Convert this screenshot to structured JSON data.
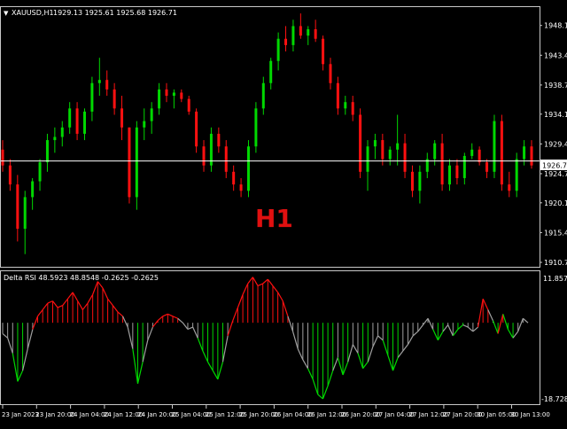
{
  "main_header": {
    "triangle": "▼",
    "symbol_timeframe": "XAUUSD,H1",
    "ohlc": "1929.13 1925.61 1925.68 1926.71"
  },
  "watermark": "H1",
  "price_axis": {
    "labels": [
      "1948.10",
      "1943.40",
      "1938.70",
      "1934.10",
      "1929.40",
      "1924.70",
      "1920.10",
      "1915.40",
      "1910.70"
    ],
    "current_price": "1926.71"
  },
  "indicator_header": "Delta RSI 48.5923 48.8548 -0.2625 -0.2625",
  "indicator_axis": {
    "top": "11.8576",
    "bottom": "-18.7285"
  },
  "time_axis": {
    "labels": [
      "23 Jan 2023",
      "23 Jan 20:00",
      "24 Jan 04:00",
      "24 Jan 12:00",
      "24 Jan 20:00",
      "25 Jan 04:00",
      "25 Jan 12:00",
      "25 Jan 20:00",
      "26 Jan 04:00",
      "26 Jan 12:00",
      "26 Jan 20:00",
      "27 Jan 04:00",
      "27 Jan 12:00",
      "27 Jan 20:00",
      "30 Jan 05:00",
      "30 Jan 13:00"
    ]
  },
  "colors": {
    "background": "#000000",
    "bull": "#00d800",
    "bear": "#ff1010",
    "neutral": "#a0a0a0",
    "frame": "#c8c8c8",
    "text": "#ffffff",
    "watermark": "#e01010"
  },
  "chart_data": [
    {
      "type": "candlestick",
      "y_axis_ticks": [
        1948.1,
        1943.4,
        1938.7,
        1934.1,
        1929.4,
        1924.7,
        1920.1,
        1915.4,
        1910.7
      ],
      "ylim": [
        1910.0,
        1951.0
      ],
      "current_price": 1926.71,
      "ohlc": [
        [
          1928.5,
          1930.0,
          1925.0,
          1926.0
        ],
        [
          1926.0,
          1927.0,
          1922.0,
          1923.0
        ],
        [
          1923.0,
          1924.5,
          1914.0,
          1916.0
        ],
        [
          1916.0,
          1922.0,
          1912.0,
          1921.0
        ],
        [
          1921.0,
          1924.0,
          1919.0,
          1923.5
        ],
        [
          1923.5,
          1927.0,
          1922.0,
          1926.5
        ],
        [
          1926.5,
          1931.0,
          1925.0,
          1930.0
        ],
        [
          1930.0,
          1932.0,
          1928.0,
          1930.5
        ],
        [
          1930.5,
          1933.0,
          1929.0,
          1932.0
        ],
        [
          1932.0,
          1936.0,
          1931.0,
          1935.0
        ],
        [
          1935.0,
          1936.0,
          1930.0,
          1931.0
        ],
        [
          1931.0,
          1935.0,
          1930.0,
          1934.5
        ],
        [
          1934.5,
          1940.0,
          1933.0,
          1939.0
        ],
        [
          1939.0,
          1943.0,
          1937.0,
          1939.5
        ],
        [
          1939.5,
          1941.0,
          1937.0,
          1938.0
        ],
        [
          1938.0,
          1939.0,
          1934.0,
          1935.0
        ],
        [
          1935.0,
          1937.0,
          1930.0,
          1932.0
        ],
        [
          1932.0,
          1932.0,
          1920.0,
          1921.0
        ],
        [
          1921.0,
          1933.0,
          1919.0,
          1932.0
        ],
        [
          1932.0,
          1935.0,
          1930.0,
          1933.0
        ],
        [
          1933.0,
          1936.0,
          1931.0,
          1935.0
        ],
        [
          1935.0,
          1939.0,
          1934.0,
          1938.0
        ],
        [
          1938.0,
          1939.0,
          1936.0,
          1937.0
        ],
        [
          1937.0,
          1938.0,
          1935.0,
          1937.5
        ],
        [
          1937.5,
          1938.0,
          1936.0,
          1936.5
        ],
        [
          1936.5,
          1937.0,
          1934.0,
          1934.5
        ],
        [
          1934.5,
          1935.0,
          1928.0,
          1929.0
        ],
        [
          1929.0,
          1930.0,
          1925.0,
          1926.0
        ],
        [
          1926.0,
          1932.0,
          1925.0,
          1931.0
        ],
        [
          1931.0,
          1932.0,
          1928.0,
          1929.0
        ],
        [
          1929.0,
          1930.0,
          1924.0,
          1925.0
        ],
        [
          1925.0,
          1926.0,
          1922.0,
          1923.0
        ],
        [
          1923.0,
          1924.0,
          1921.0,
          1922.0
        ],
        [
          1922.0,
          1930.0,
          1921.0,
          1929.0
        ],
        [
          1929.0,
          1936.0,
          1928.0,
          1935.0
        ],
        [
          1935.0,
          1940.0,
          1934.0,
          1939.0
        ],
        [
          1939.0,
          1943.0,
          1938.0,
          1942.5
        ],
        [
          1942.5,
          1947.0,
          1941.0,
          1946.0
        ],
        [
          1946.0,
          1948.0,
          1944.0,
          1945.0
        ],
        [
          1945.0,
          1949.0,
          1944.0,
          1948.0
        ],
        [
          1948.0,
          1950.0,
          1946.0,
          1946.5
        ],
        [
          1946.5,
          1948.0,
          1945.0,
          1947.5
        ],
        [
          1947.5,
          1949.0,
          1945.5,
          1946.0
        ],
        [
          1946.0,
          1946.5,
          1941.0,
          1942.0
        ],
        [
          1942.0,
          1943.0,
          1938.0,
          1939.0
        ],
        [
          1939.0,
          1940.0,
          1934.0,
          1935.0
        ],
        [
          1935.0,
          1937.0,
          1934.0,
          1936.0
        ],
        [
          1936.0,
          1937.0,
          1933.0,
          1934.0
        ],
        [
          1934.0,
          1935.0,
          1924.0,
          1925.0
        ],
        [
          1925.0,
          1930.0,
          1922.0,
          1929.0
        ],
        [
          1929.0,
          1931.0,
          1927.0,
          1930.0
        ],
        [
          1930.0,
          1931.0,
          1926.0,
          1927.0
        ],
        [
          1927.0,
          1929.0,
          1926.0,
          1928.5
        ],
        [
          1928.5,
          1934.0,
          1926.0,
          1929.5
        ],
        [
          1929.5,
          1931.0,
          1924.0,
          1925.0
        ],
        [
          1925.0,
          1926.0,
          1921.0,
          1922.0
        ],
        [
          1922.0,
          1926.0,
          1920.0,
          1925.0
        ],
        [
          1925.0,
          1928.0,
          1924.0,
          1927.0
        ],
        [
          1927.0,
          1930.0,
          1926.0,
          1929.5
        ],
        [
          1929.5,
          1931.0,
          1922.0,
          1923.0
        ],
        [
          1923.0,
          1927.0,
          1922.0,
          1926.0
        ],
        [
          1926.0,
          1927.0,
          1923.0,
          1924.0
        ],
        [
          1924.0,
          1928.0,
          1923.0,
          1927.5
        ],
        [
          1927.5,
          1929.5,
          1927.0,
          1928.5
        ],
        [
          1928.5,
          1929.0,
          1926.0,
          1926.5
        ],
        [
          1926.5,
          1927.0,
          1924.0,
          1925.0
        ],
        [
          1925.0,
          1934.0,
          1924.0,
          1933.0
        ],
        [
          1933.0,
          1934.0,
          1922.0,
          1923.0
        ],
        [
          1923.0,
          1925.0,
          1921.0,
          1922.0
        ],
        [
          1922.0,
          1928.0,
          1921.0,
          1927.0
        ],
        [
          1927.0,
          1930.0,
          1926.0,
          1929.0
        ],
        [
          1929.0,
          1930.0,
          1925.5,
          1926.0
        ]
      ]
    },
    {
      "type": "histogram",
      "title": "Delta RSI",
      "ylim": [
        -18.7285,
        11.8576
      ],
      "values": [
        -2.5,
        -3.5,
        -7.0,
        -13.5,
        -11.0,
        -6.0,
        -1.5,
        1.5,
        3.0,
        4.5,
        5.0,
        3.5,
        4.0,
        5.5,
        7.0,
        5.0,
        3.0,
        4.5,
        6.5,
        9.5,
        8.0,
        5.5,
        4.0,
        2.5,
        1.5,
        -1.0,
        -6.0,
        -14.0,
        -9.0,
        -4.0,
        -1.0,
        0.5,
        1.5,
        2.0,
        1.5,
        1.0,
        0.0,
        -1.5,
        -1.0,
        -3.5,
        -6.5,
        -9.0,
        -11.0,
        -13.0,
        -9.0,
        -3.0,
        0.5,
        3.5,
        6.5,
        9.0,
        10.5,
        8.5,
        9.0,
        10.0,
        8.5,
        7.0,
        5.0,
        1.5,
        -2.0,
        -6.0,
        -8.5,
        -10.5,
        -13.0,
        -16.5,
        -17.5,
        -14.5,
        -11.0,
        -8.0,
        -12.0,
        -9.0,
        -5.0,
        -7.0,
        -10.5,
        -9.0,
        -5.5,
        -3.0,
        -4.0,
        -7.5,
        -11.0,
        -8.0,
        -6.5,
        -5.0,
        -3.0,
        -2.0,
        -0.5,
        1.0,
        -1.5,
        -4.0,
        -2.0,
        -0.5,
        -3.0,
        -1.5,
        -0.5,
        -1.0,
        -2.0,
        -1.0,
        5.5,
        3.0,
        0.5,
        -2.5,
        2.0,
        -1.5,
        -3.5,
        -2.0,
        1.0,
        0.0
      ],
      "colors": [
        "neutral",
        "neutral",
        "neutral",
        "bull",
        "bull",
        "neutral",
        "neutral",
        "bear",
        "bear",
        "bear",
        "bear",
        "bear",
        "bear",
        "bear",
        "bear",
        "bear",
        "bear",
        "bear",
        "bear",
        "bear",
        "bear",
        "bear",
        "bear",
        "bear",
        "bear",
        "neutral",
        "neutral",
        "bull",
        "bull",
        "neutral",
        "neutral",
        "bear",
        "bear",
        "bear",
        "bear",
        "bear",
        "neutral",
        "neutral",
        "neutral",
        "neutral",
        "bull",
        "bull",
        "bull",
        "bull",
        "bull",
        "neutral",
        "bear",
        "bear",
        "bear",
        "bear",
        "bear",
        "bear",
        "bear",
        "bear",
        "bear",
        "bear",
        "bear",
        "bear",
        "neutral",
        "neutral",
        "neutral",
        "neutral",
        "bull",
        "bull",
        "bull",
        "bull",
        "bull",
        "neutral",
        "bull",
        "bull",
        "neutral",
        "neutral",
        "bull",
        "bull",
        "neutral",
        "neutral",
        "neutral",
        "bull",
        "bull",
        "bull",
        "neutral",
        "neutral",
        "neutral",
        "neutral",
        "neutral",
        "neutral",
        "neutral",
        "bull",
        "bull",
        "neutral",
        "neutral",
        "bull",
        "bull",
        "neutral",
        "neutral",
        "neutral",
        "bear",
        "bear",
        "neutral",
        "bull",
        "bear",
        "bull",
        "bull",
        "neutral",
        "neutral",
        "neutral"
      ]
    }
  ]
}
